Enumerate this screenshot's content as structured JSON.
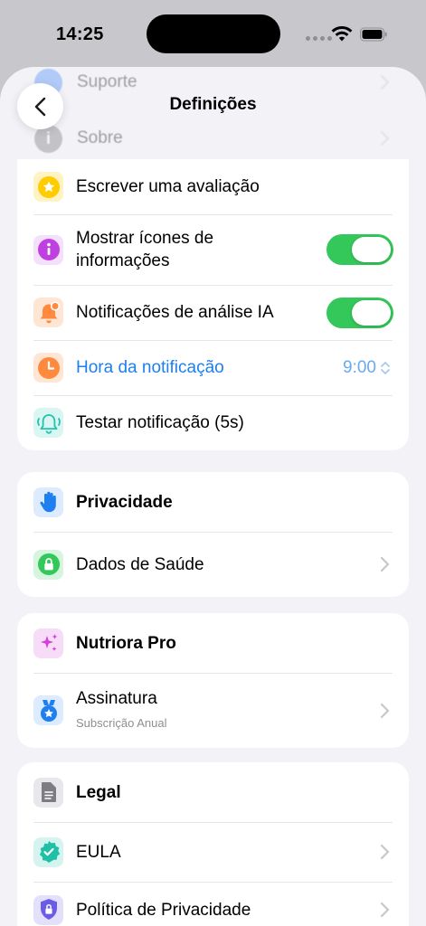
{
  "status_bar": {
    "time": "14:25"
  },
  "header": {
    "title": "Definições"
  },
  "faded_rows": [
    {
      "label": "Suporte"
    },
    {
      "label": "Sobre",
      "icon_glyph": "i"
    }
  ],
  "general": {
    "items": [
      {
        "label": "Escrever uma avaliação",
        "icon": "star-icon"
      },
      {
        "label": "Mostrar ícones de informações",
        "icon": "info-icon",
        "toggle": true
      },
      {
        "label": "Notificações de análise IA",
        "icon": "bell-badge-icon",
        "toggle": true
      },
      {
        "label": "Hora da notificação",
        "icon": "clock-icon",
        "value": "9:00"
      },
      {
        "label": "Testar notificação (5s)",
        "icon": "bell-ringing-icon"
      }
    ]
  },
  "privacy": {
    "header": "Privacidade",
    "items": [
      {
        "label": "Dados de Saúde",
        "icon": "lock-icon"
      }
    ]
  },
  "pro": {
    "header": "Nutriora Pro",
    "items": [
      {
        "label": "Assinatura",
        "subtitle": "Subscrição Anual",
        "icon": "medal-icon"
      }
    ]
  },
  "legal": {
    "header": "Legal",
    "items": [
      {
        "label": "EULA",
        "icon": "checkmark-seal-icon"
      },
      {
        "label": "Política de Privacidade",
        "icon": "lock-shield-icon"
      }
    ]
  },
  "colors": {
    "accent_blue": "#1e7ff0",
    "toggle_green": "#34c759",
    "background": "#f2f2f7"
  }
}
